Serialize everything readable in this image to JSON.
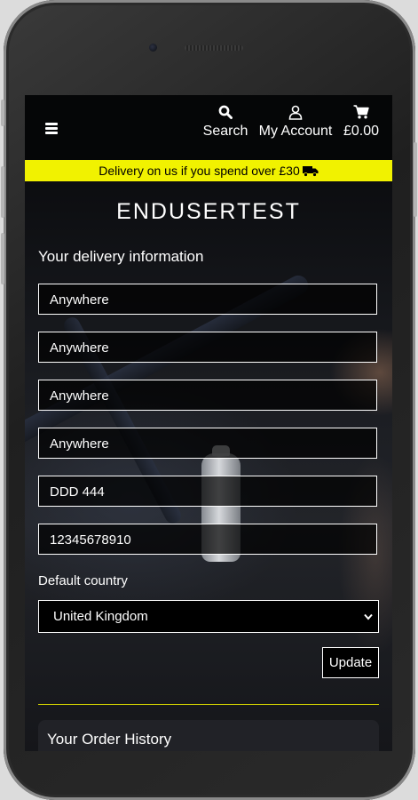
{
  "nav": {
    "search_label": "Search",
    "account_label": "My Account",
    "cart_total": "£0.00",
    "menu_icon": "hamburger-icon",
    "search_icon": "search-icon",
    "account_icon": "user-icon",
    "cart_icon": "cart-icon"
  },
  "banner": {
    "text": "Delivery on us if you spend over £30",
    "icon": "truck-icon",
    "background": "#f1f200"
  },
  "brand": "ENDUSERTEST",
  "delivery": {
    "title": "Your delivery information",
    "fields": [
      "Anywhere",
      "Anywhere",
      "Anywhere",
      "Anywhere",
      "DDD 444",
      "12345678910"
    ],
    "country_label": "Default country",
    "country_value": "United Kingdom",
    "update_label": "Update"
  },
  "history": {
    "title": "Your Order History"
  },
  "colors": {
    "accent": "#f1f200",
    "nav_background": "#050607"
  }
}
